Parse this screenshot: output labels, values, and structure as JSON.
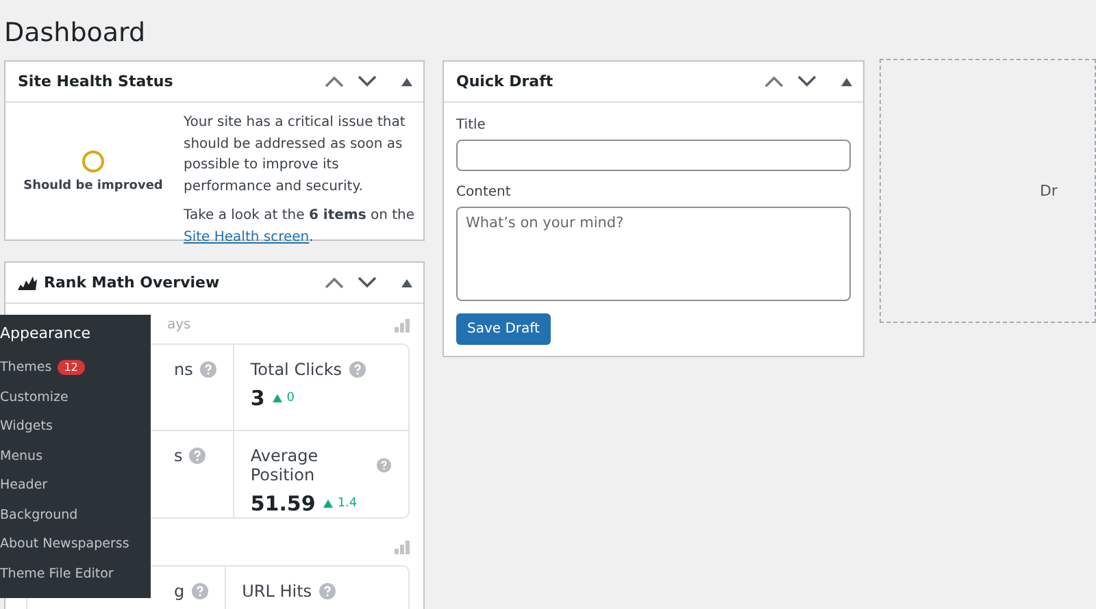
{
  "page_title": "Dashboard",
  "site_health": {
    "title": "Site Health Status",
    "status": "Should be improved",
    "message": "Your site has a critical issue that should be addressed as soon as possible to improve its performance and security.",
    "detail": "Take a look at the **6 items** on the ",
    "link": "Site Health screen",
    "detail_end": "."
  },
  "rank_math": {
    "title": "Rank Math Overview",
    "period_text": "ays",
    "stats": [
      {
        "label": "ns"
      },
      {
        "label": "Total Clicks",
        "value": "3",
        "change": "0"
      },
      {
        "label": "s"
      },
      {
        "label": "Average Position",
        "value": "51.59",
        "change": "1.4"
      }
    ],
    "stats_2": [
      {
        "label": "g"
      },
      {
        "label": "URL Hits"
      }
    ]
  },
  "appearance_menu": {
    "title": "Appearance",
    "items": [
      {
        "label": "Themes",
        "badge": "12"
      },
      {
        "label": "Customize"
      },
      {
        "label": "Widgets"
      },
      {
        "label": "Menus"
      },
      {
        "label": "Header"
      },
      {
        "label": "Background"
      },
      {
        "label": "About Newspaperss"
      },
      {
        "label": "Theme File Editor"
      }
    ]
  },
  "quick_draft": {
    "title": "Quick Draft",
    "title_label": "Title",
    "content_label": "Content",
    "content_placeholder": "What’s on your mind?",
    "button": "Save Draft"
  },
  "drop_zone": {
    "text": "Dr"
  }
}
